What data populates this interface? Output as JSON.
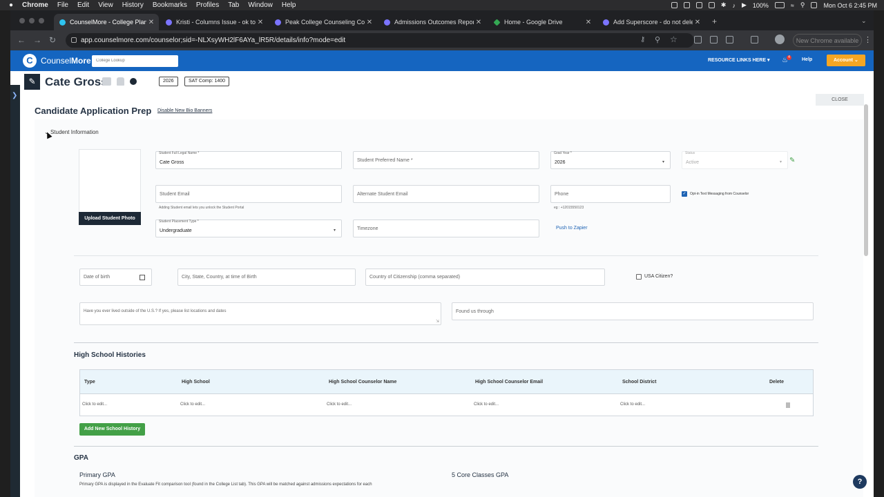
{
  "menubar": {
    "app": "Chrome",
    "items": [
      "File",
      "Edit",
      "View",
      "History",
      "Bookmarks",
      "Profiles",
      "Tab",
      "Window",
      "Help"
    ],
    "battery": "100%",
    "clock": "Mon Oct 6  2:45 PM"
  },
  "tabs": [
    {
      "title": "CounselMore - College Planni",
      "active": true
    },
    {
      "title": "Kristi - Columns Issue - ok to",
      "active": false
    },
    {
      "title": "Peak College Counseling Colle",
      "active": false
    },
    {
      "title": "Admissions Outcomes Report",
      "active": false
    },
    {
      "title": "Home - Google Drive",
      "active": false
    },
    {
      "title": "Add Superscore - do not dele",
      "active": false
    }
  ],
  "address": {
    "url": "app.counselmore.com/counselor;sid=-NLXsyWH2lF6AYa_lR5R/details/info?mode=edit",
    "new_chrome": "New Chrome available"
  },
  "appnav": {
    "brand_a": "Counsel",
    "brand_b": "More",
    "lookup_placeholder": "College Lookup",
    "resource_links": "RESOURCE LINKS HERE",
    "bell_count": "4",
    "help": "Help",
    "account": "Account"
  },
  "student": {
    "name": "Cate Gross",
    "grad_badge": "2026",
    "sat_badge": "SAT   Comp: 1400",
    "close": "CLOSE"
  },
  "prep": {
    "title": "Candidate Application Prep",
    "disable_link": "Disable New Bio Banners",
    "section_toggle": "Student Information",
    "upload_photo": "Upload Student Photo",
    "fields": {
      "legal_name_label": "Student Full Legal Name *",
      "legal_name_value": "Cate Gross",
      "preferred_name": "Student Preferred Name *",
      "grad_year_label": "Grad Year *",
      "grad_year_value": "2026",
      "status_label": "Status",
      "status_value": "Active",
      "student_email": "Student Email",
      "student_email_help": "Adding Student email lets you unlock the Student Portal",
      "alt_email": "Alternate Student Email",
      "phone": "Phone",
      "phone_help": "eg : +12015550123",
      "opt_in": "Opt-in Text Messaging from Counselor",
      "placement_label": "Student Placement Type *",
      "placement_value": "Undergraduate",
      "timezone": "Timezone",
      "push_zapier": "Push to Zapier",
      "dob": "Date of birth",
      "birth_city": "City, State, Country, at time of Birth",
      "citizenship": "Country of Citizenship (comma separated)",
      "usa_citizen": "USA Citizen?",
      "lived_outside": "Have you ever lived outside of the U.S.? If yes, please list locations and dates",
      "found_us": "Found us through"
    }
  },
  "histories": {
    "title": "High School Histories",
    "columns": [
      "Type",
      "High School",
      "High School Counselor Name",
      "High School Counselor Email",
      "School District",
      "Delete"
    ],
    "row": [
      "Click to edit...",
      "Click to edit...",
      "Click to edit...",
      "Click to edit...",
      "Click to edit..."
    ],
    "add_button": "Add New School History"
  },
  "gpa": {
    "title": "GPA",
    "primary": "Primary GPA",
    "core": "5 Core Classes GPA",
    "desc": "Primary GPA is displayed in the Evaluate Fit comparison tool (found in the College List tab). This GPA will be matched against admissions expectations for each"
  }
}
